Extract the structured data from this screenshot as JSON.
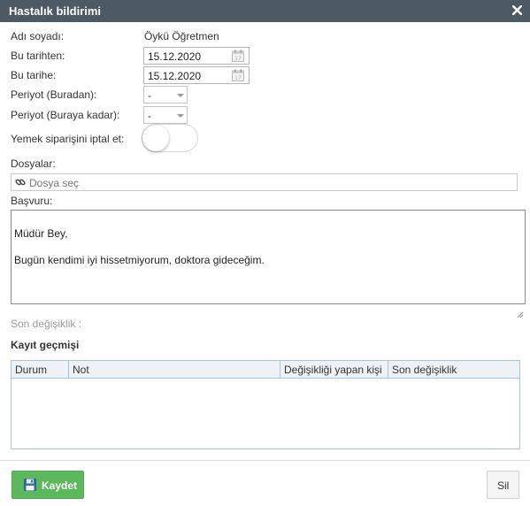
{
  "dialog": {
    "title": "Hastalık bildirimi",
    "close_icon": "close-icon"
  },
  "form": {
    "name_label": "Adı soyadı:",
    "name_value": "Öykü Öğretmen",
    "from_label": "Bu tarihten:",
    "from_value": "15.12.2020",
    "to_label": "Bu tarihe:",
    "to_value": "15.12.2020",
    "period_from_label": "Periyot (Buradan):",
    "period_from_value": "-",
    "period_to_label": "Periyot (Buraya kadar):",
    "period_to_value": "-",
    "cancel_meal_label": "Yemek siparişini iptal et:",
    "cancel_meal_on": false,
    "files_label": "Dosyalar:",
    "files_placeholder": "Dosya seç",
    "application_label": "Başvuru:",
    "application_text": "Müdür Bey,\n\nBugün kendimi iyi hissetmiyorum, doktora gideceğim.",
    "last_change_label": "Son değişiklik :"
  },
  "history": {
    "title": "Kayıt geçmişi",
    "columns": [
      "Durum",
      "Not",
      "Değişikliği yapan kişi",
      "Son değişiklik"
    ],
    "rows": []
  },
  "footer": {
    "save_label": "Kaydet",
    "delete_label": "Sil"
  },
  "colors": {
    "titlebar": "#4d5965",
    "save_button": "#5cb85c",
    "grid_border": "#a8c4dc"
  }
}
